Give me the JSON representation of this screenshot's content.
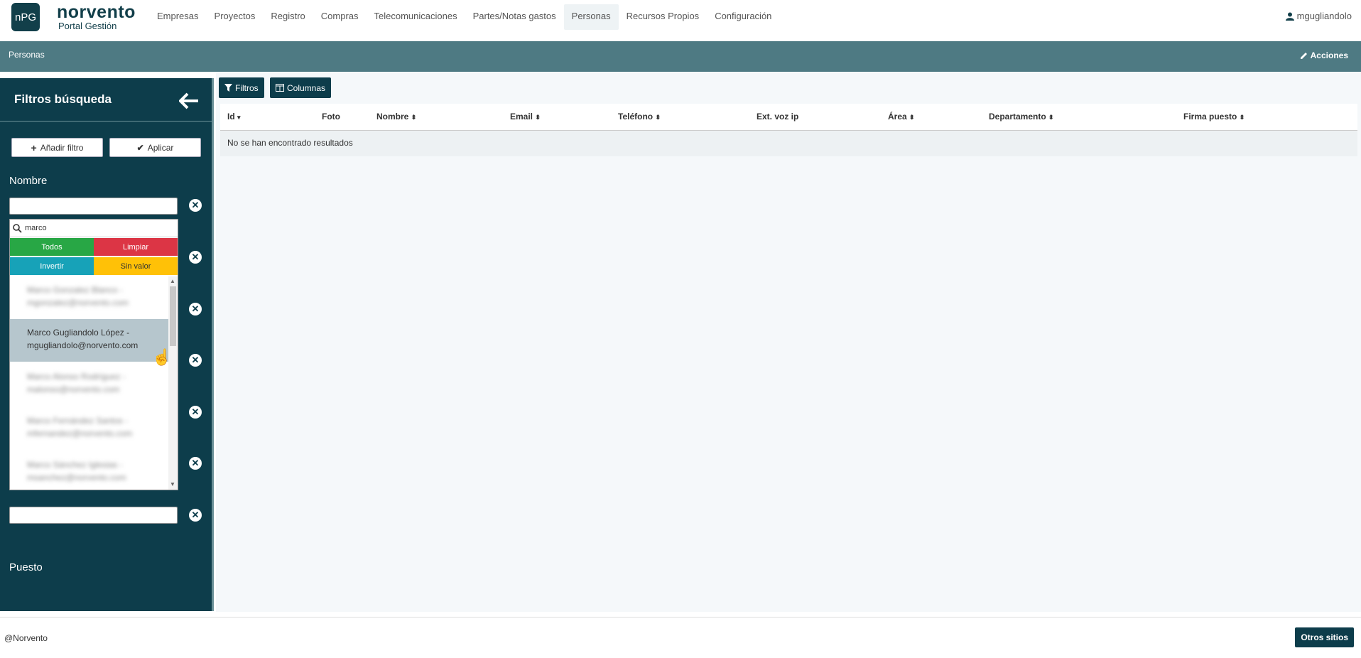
{
  "app": {
    "logo": "nPG",
    "brand": "norvento",
    "subtitle": "Portal Gestión"
  },
  "nav": [
    "Empresas",
    "Proyectos",
    "Registro",
    "Compras",
    "Telecomunicaciones",
    "Partes/Notas gastos",
    "Personas",
    "Recursos Propios",
    "Configuración"
  ],
  "user": {
    "name": "mgugliandolo",
    "icon": "user-icon"
  },
  "titlebar": {
    "title": "Personas",
    "actions": "Acciones"
  },
  "sidebar": {
    "title": "Filtros búsqueda",
    "add_filter": "Añadir filtro",
    "apply": "Aplicar",
    "nombre_label": "Nombre",
    "puesto_label": "Puesto",
    "dropdown": {
      "search_value": "marco",
      "btn_all": "Todos",
      "btn_clear": "Limpiar",
      "btn_invert": "Invertir",
      "btn_none": "Sin valor",
      "items": [
        {
          "line1": "Marco Gonzalez Blanco -",
          "line2": "mgonzalez@norvento.com"
        },
        {
          "line1": "Marco Gugliandolo López -",
          "line2": "mgugliandolo@norvento.com"
        },
        {
          "line1": "Marco Alonso Rodríguez -",
          "line2": "malonso@norvento.com"
        },
        {
          "line1": "Marco Fernández Santos -",
          "line2": "mfernandez@norvento.com"
        },
        {
          "line1": "Marco Sánchez Iglesias -",
          "line2": "msanchez@norvento.com"
        }
      ]
    }
  },
  "toolbar": {
    "filters": "Filtros",
    "columns": "Columnas"
  },
  "table": {
    "columns": [
      "Id",
      "Foto",
      "Nombre",
      "Email",
      "Teléfono",
      "Ext. voz ip",
      "Área",
      "Departamento",
      "Firma puesto"
    ],
    "empty": "No se han encontrado resultados"
  },
  "footer": {
    "copyright": "@Norvento",
    "other_sites": "Otros sitios"
  },
  "colors": {
    "primary": "#0d3d4b",
    "titlebar": "#4e7a83",
    "green": "#28a745",
    "red": "#dc3545",
    "cyan": "#17a2b8",
    "yellow": "#ffc107"
  }
}
